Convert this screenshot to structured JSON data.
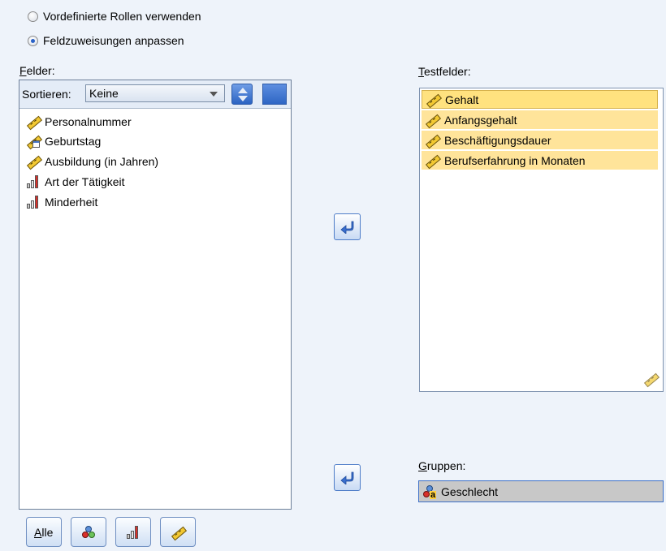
{
  "radios": [
    {
      "label": "Vordefinierte Rollen verwenden",
      "selected": false
    },
    {
      "label": "Feldzuweisungen anpassen",
      "selected": true
    }
  ],
  "fields_panel": {
    "title": "Felder:",
    "sort_label": "Sortieren:",
    "sort_value": "Keine",
    "items": [
      {
        "label": "Personalnummer",
        "icon": "scale-ruler-icon"
      },
      {
        "label": "Geburtstag",
        "icon": "date-icon"
      },
      {
        "label": "Ausbildung (in Jahren)",
        "icon": "scale-ruler-icon"
      },
      {
        "label": "Art der Tätigkeit",
        "icon": "ordinal-bars-icon"
      },
      {
        "label": "Minderheit",
        "icon": "ordinal-bars-icon"
      }
    ],
    "filter_buttons": [
      {
        "label": "Alle",
        "icon": null
      },
      {
        "label": "",
        "icon": "nominal-circles-icon"
      },
      {
        "label": "",
        "icon": "ordinal-bars-icon"
      },
      {
        "label": "",
        "icon": "scale-ruler-icon"
      }
    ]
  },
  "test_panel": {
    "title": "Testfelder:",
    "items": [
      {
        "label": "Gehalt",
        "icon": "scale-ruler-icon"
      },
      {
        "label": "Anfangsgehalt",
        "icon": "scale-ruler-icon"
      },
      {
        "label": "Beschäftigungsdauer",
        "icon": "scale-ruler-icon"
      },
      {
        "label": "Berufserfahrung in Monaten",
        "icon": "scale-ruler-icon"
      }
    ]
  },
  "groups_panel": {
    "title": "Gruppen:",
    "value": "Geschlecht",
    "icon": "nominal-string-icon"
  },
  "colors": {
    "selection": "#ffe49a",
    "accent": "#2b63c2",
    "background": "#eef3fa"
  }
}
